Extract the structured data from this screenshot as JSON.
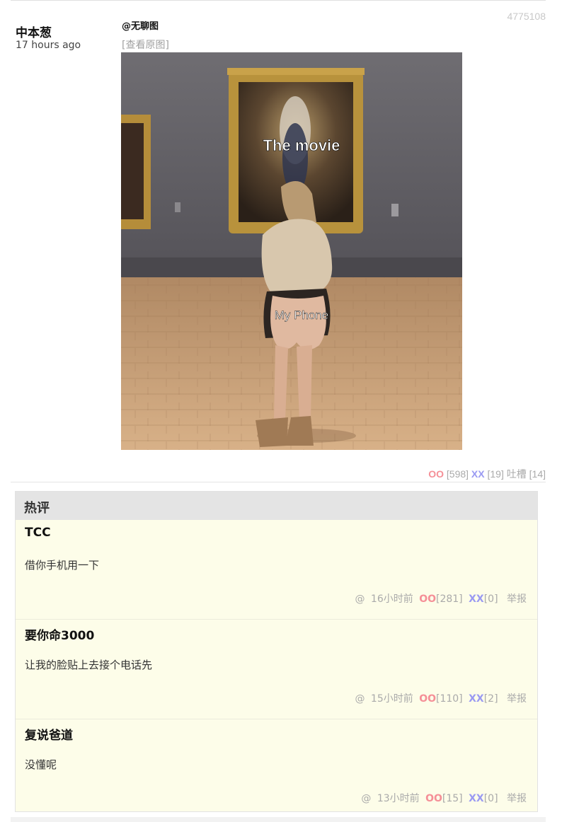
{
  "post": {
    "id": "4775108",
    "author": "中本葱",
    "time_ago": "17 hours ago",
    "mention": "@无聊图",
    "view_original": "[查看原图]",
    "image": {
      "top_caption": "The movie",
      "bottom_caption": "My Phone"
    },
    "votes": {
      "oo_label": "OO",
      "oo_count": "[598]",
      "xx_label": "XX",
      "xx_count": "[19]",
      "comments_label": "吐槽",
      "comments_count": "[14]"
    }
  },
  "hot_comments": {
    "title": "热评",
    "items": [
      {
        "author": "TCC",
        "text": "借你手机用一下",
        "at": "@",
        "time": "16小时前",
        "oo_label": "OO",
        "oo": "[281]",
        "xx_label": "XX",
        "xx": "[0]",
        "report": "举报"
      },
      {
        "author": "要你命3000",
        "text": "让我的脸贴上去接个电话先",
        "at": "@",
        "time": "15小时前",
        "oo_label": "OO",
        "oo": "[110]",
        "xx_label": "XX",
        "xx": "[2]",
        "report": "举报"
      },
      {
        "author": "复说爸道",
        "text": "没懂呢",
        "at": "@",
        "time": "13小时前",
        "oo_label": "OO",
        "oo": "[15]",
        "xx_label": "XX",
        "xx": "[0]",
        "report": "举报"
      }
    ]
  },
  "colors": {
    "oo": "#f58f97",
    "xx": "#9a9af2",
    "hot_background": "#fdfde9",
    "hot_header": "#e4e4e4"
  }
}
